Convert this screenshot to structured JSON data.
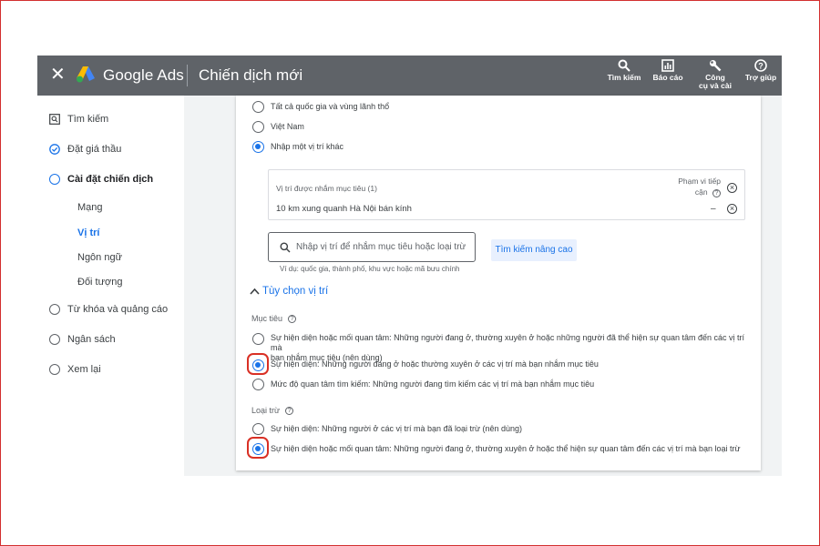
{
  "topbar": {
    "close_icon": "close-icon",
    "brand": "Google Ads",
    "title": "Chiến dịch mới",
    "tools": [
      {
        "icon": "search-icon",
        "label": "Tìm kiếm"
      },
      {
        "icon": "report-icon",
        "label": "Báo cáo"
      },
      {
        "icon": "wrench-icon",
        "label_line1": "Công",
        "label_line2": "cụ và cài"
      },
      {
        "icon": "help-icon",
        "label": "Trợ giúp"
      }
    ]
  },
  "sidebar": {
    "items": [
      {
        "label": "Tìm kiếm",
        "icon": "search-box-icon"
      },
      {
        "label": "Đặt giá thầu",
        "icon": "check-circle-icon"
      },
      {
        "label": "Cài đặt chiến dịch",
        "icon": "circle-icon"
      },
      {
        "label": "Từ khóa và quảng cáo",
        "icon": "circle-icon"
      },
      {
        "label": "Ngân sách",
        "icon": "circle-icon"
      },
      {
        "label": "Xem lại",
        "icon": "circle-icon"
      }
    ],
    "subitems": [
      "Mạng",
      "Vị trí",
      "Ngôn ngữ",
      "Đối tượng"
    ],
    "active_subitem": "Vị trí"
  },
  "locations": {
    "options": [
      "Tất cả quốc gia và vùng lãnh thổ",
      "Việt Nam",
      "Nhập một vị trí khác"
    ],
    "selected": "Nhập một vị trí khác",
    "targeted_header": "Vị trí được nhắm mục tiêu (1)",
    "reach_header_line1": "Phạm vi tiếp",
    "reach_header_line2": "cận",
    "targeted_item": "10 km xung quanh Hà Nội bán kính",
    "reach_value": "–",
    "search_placeholder": "Nhập vị trí để nhắm mục tiêu hoặc loại trừ",
    "search_hint": "Ví dụ: quốc gia, thành phố, khu vực hoặc mã bưu chính",
    "advanced_search": "Tìm kiếm nâng cao"
  },
  "location_options": {
    "title": "Tùy chọn vị trí",
    "target_label": "Mục tiêu",
    "target_options": [
      {
        "line1": "Sự hiện diện hoặc mối quan tâm: Những người đang ở, thường xuyên ở hoặc những người đã thể hiện sự quan tâm đến các vị trí mà",
        "line2": "bạn nhắm mục tiêu (nên dùng)"
      },
      {
        "line1": "Sự hiện diện: Những người đang ở hoặc thường xuyên ở các vị trí mà bạn nhắm mục tiêu"
      },
      {
        "line1": "Mức độ quan tâm tìm kiếm: Những người đang tìm kiếm các vị trí mà bạn nhắm mục tiêu"
      }
    ],
    "target_selected_index": 1,
    "exclude_label": "Loại trừ",
    "exclude_options": [
      {
        "line1": "Sự hiện diện: Những người ở các vị trí mà bạn đã loại trừ (nên dùng)"
      },
      {
        "line1": "Sự hiện diện hoặc mối quan tâm: Những người đang ở, thường xuyên ở hoặc thể hiện sự quan tâm đến các vị trí mà bạn loại trừ"
      }
    ],
    "exclude_selected_index": 1
  },
  "colors": {
    "topbar": "#5f6368",
    "accent": "#1a73e8",
    "highlight": "#d93025"
  }
}
